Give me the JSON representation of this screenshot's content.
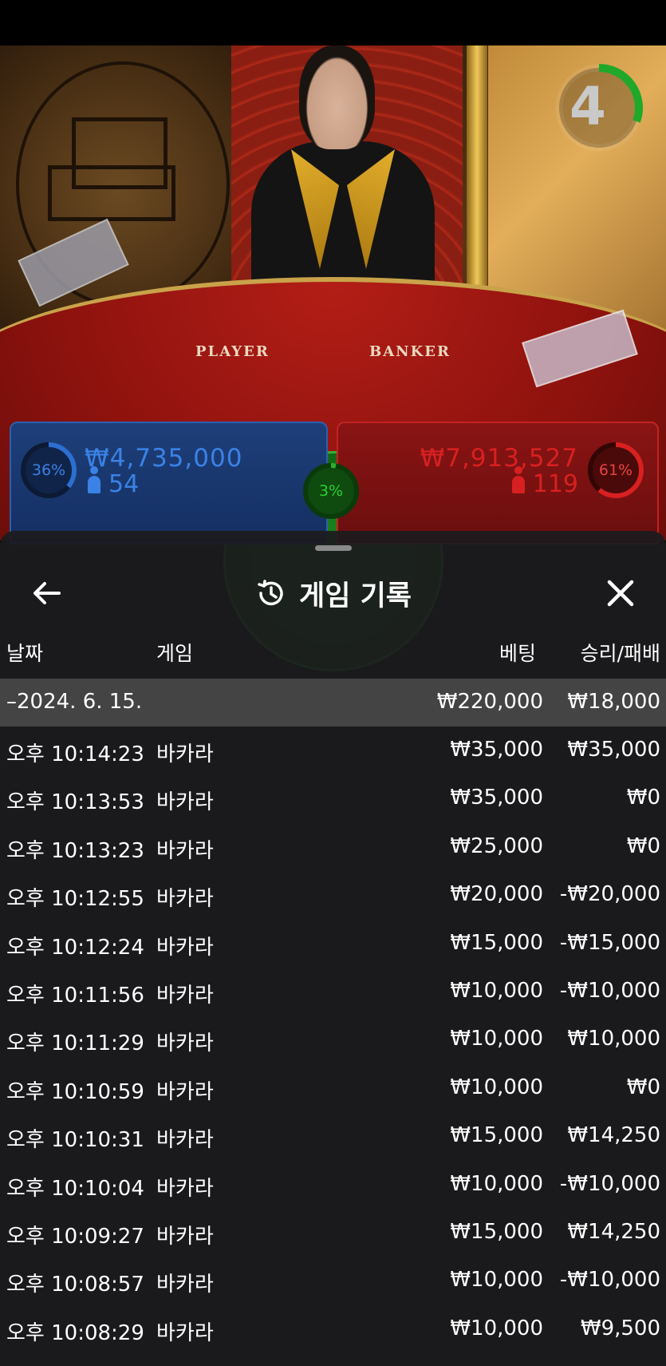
{
  "timer": {
    "value": "4"
  },
  "table": {
    "player_text": "PLAYER",
    "banker_text": "BANKER"
  },
  "bets": {
    "player": {
      "percent": "36%",
      "percent_value": 36,
      "amount": "₩4,735,000",
      "players": "54",
      "color": "#2c6fd0"
    },
    "tie": {
      "percent": "3%",
      "percent_value": 3,
      "color": "#2bb02b"
    },
    "banker": {
      "percent": "61%",
      "percent_value": 61,
      "amount": "₩7,913,527",
      "players": "119",
      "color": "#d82020"
    }
  },
  "panel": {
    "title": "게임 기록",
    "columns": {
      "date": "날짜",
      "game": "게임",
      "bet": "베팅",
      "result": "승리/패배"
    },
    "date_row": {
      "date": "–2024. 6. 15.",
      "bet": "₩220,000",
      "result": "₩18,000"
    },
    "rows": [
      {
        "time": "오후 10:14:23",
        "game": "바카라",
        "bet": "₩35,000",
        "result": "₩35,000"
      },
      {
        "time": "오후 10:13:53",
        "game": "바카라",
        "bet": "₩35,000",
        "result": "₩0"
      },
      {
        "time": "오후 10:13:23",
        "game": "바카라",
        "bet": "₩25,000",
        "result": "₩0"
      },
      {
        "time": "오후 10:12:55",
        "game": "바카라",
        "bet": "₩20,000",
        "result": "-₩20,000"
      },
      {
        "time": "오후 10:12:24",
        "game": "바카라",
        "bet": "₩15,000",
        "result": "-₩15,000"
      },
      {
        "time": "오후 10:11:56",
        "game": "바카라",
        "bet": "₩10,000",
        "result": "-₩10,000"
      },
      {
        "time": "오후 10:11:29",
        "game": "바카라",
        "bet": "₩10,000",
        "result": "₩10,000"
      },
      {
        "time": "오후 10:10:59",
        "game": "바카라",
        "bet": "₩10,000",
        "result": "₩0"
      },
      {
        "time": "오후 10:10:31",
        "game": "바카라",
        "bet": "₩15,000",
        "result": "₩14,250"
      },
      {
        "time": "오후 10:10:04",
        "game": "바카라",
        "bet": "₩10,000",
        "result": "-₩10,000"
      },
      {
        "time": "오후 10:09:27",
        "game": "바카라",
        "bet": "₩15,000",
        "result": "₩14,250"
      },
      {
        "time": "오후 10:08:57",
        "game": "바카라",
        "bet": "₩10,000",
        "result": "-₩10,000"
      },
      {
        "time": "오후 10:08:29",
        "game": "바카라",
        "bet": "₩10,000",
        "result": "₩9,500"
      }
    ]
  },
  "icons": {
    "back": "arrow-left-icon",
    "history": "history-icon",
    "close": "close-icon"
  }
}
